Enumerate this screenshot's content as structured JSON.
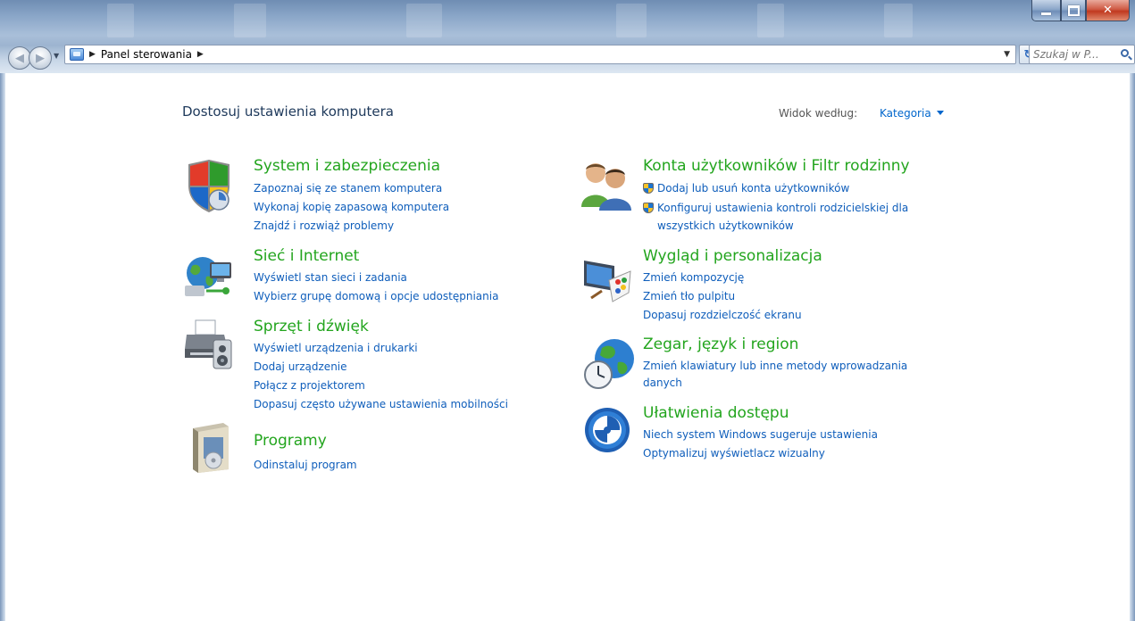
{
  "window": {
    "address_crumbs": [
      "Panel sterowania"
    ],
    "search_placeholder": "Szukaj w P...",
    "buttons": [
      "minimize-icon",
      "maximize-icon",
      "close-icon"
    ]
  },
  "header": {
    "title": "Dostosuj ustawienia komputera",
    "view_by_label": "Widok według:",
    "view_by_value": "Kategoria"
  },
  "categories": [
    {
      "title": "System i zabezpieczenia",
      "icon": "security-shield-icon",
      "links": [
        "Zapoznaj się ze stanem komputera",
        "Wykonaj kopię zapasową komputera",
        "Znajdź i rozwiąż problemy"
      ]
    },
    {
      "title": "Sieć i Internet",
      "icon": "network-globe-icon",
      "links": [
        "Wyświetl stan sieci i zadania",
        "Wybierz grupę domową i opcje udostępniania"
      ]
    },
    {
      "title": "Sprzęt i dźwięk",
      "icon": "printer-speaker-icon",
      "links": [
        "Wyświetl urządzenia i drukarki",
        "Dodaj urządzenie",
        "Połącz z projektorem",
        "Dopasuj często używane ustawienia mobilności"
      ]
    },
    {
      "title": "Programy",
      "icon": "programs-box-icon",
      "links": [
        "Odinstaluj program"
      ]
    },
    {
      "title": "Konta użytkowników i Filtr rodzinny",
      "icon": "users-icon",
      "links": [
        "Dodaj lub usuń konta użytkowników",
        "Konfiguruj ustawienia kontroli rodzicielskiej dla",
        "wszystkich użytkowników"
      ],
      "link_icon": "uac-shield-icon"
    },
    {
      "title": "Wygląd i personalizacja",
      "icon": "monitor-paint-icon",
      "links": [
        "Zmień kompozycję",
        "Zmień tło pulpitu",
        "Dopasuj rozdzielczość ekranu"
      ]
    },
    {
      "title": "Zegar, język i region",
      "icon": "globe-clock-icon",
      "links": [
        "Zmień klawiatury lub inne metody wprowadzania",
        "danych"
      ]
    },
    {
      "title": "Ułatwienia dostępu",
      "icon": "ease-of-access-icon",
      "links": [
        "Niech system Windows sugeruje ustawienia",
        "Optymalizuj wyświetlacz wizualny"
      ]
    }
  ]
}
